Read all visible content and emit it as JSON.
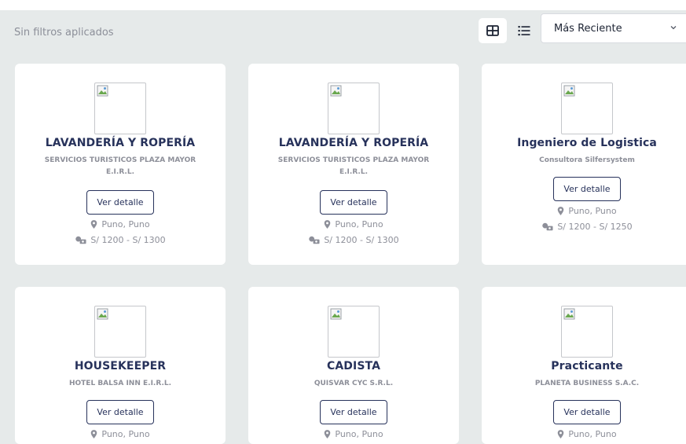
{
  "toolbar": {
    "filter_status": "Sin filtros aplicados",
    "sort_selected": "Más Reciente"
  },
  "cards": [
    {
      "title": "LAVANDERÍA Y ROPERÍA",
      "company_line1": "SERVICIOS TURISTICOS PLAZA MAYOR",
      "company_line2": "E.I.R.L.",
      "button": "Ver detalle",
      "location": "Puno, Puno",
      "salary": "S/ 1200 - S/ 1300"
    },
    {
      "title": "LAVANDERÍA Y ROPERÍA",
      "company_line1": "SERVICIOS TURISTICOS PLAZA MAYOR",
      "company_line2": "E.I.R.L.",
      "button": "Ver detalle",
      "location": "Puno, Puno",
      "salary": "S/ 1200 - S/ 1300"
    },
    {
      "title": "Ingeniero de Logistica",
      "company_line1": "Consultora Silfersystem",
      "button": "Ver detalle",
      "location": "Puno, Puno",
      "salary": "S/ 1200 - S/ 1250"
    },
    {
      "title": "HOUSEKEEPER",
      "company_line1": "HOTEL BALSA INN E.I.R.L.",
      "button": "Ver detalle",
      "location": "Puno, Puno"
    },
    {
      "title": "CADISTA",
      "company_line1": "QUISVAR CYC S.R.L.",
      "button": "Ver detalle",
      "location": "Puno, Puno"
    },
    {
      "title": "Practicante",
      "company_line1": "PLANETA BUSINESS S.A.C.",
      "button": "Ver detalle",
      "location": "Puno, Puno"
    }
  ],
  "colors": {
    "title": "#27325b",
    "muted": "#8d8f99",
    "background": "#e6eaea"
  }
}
